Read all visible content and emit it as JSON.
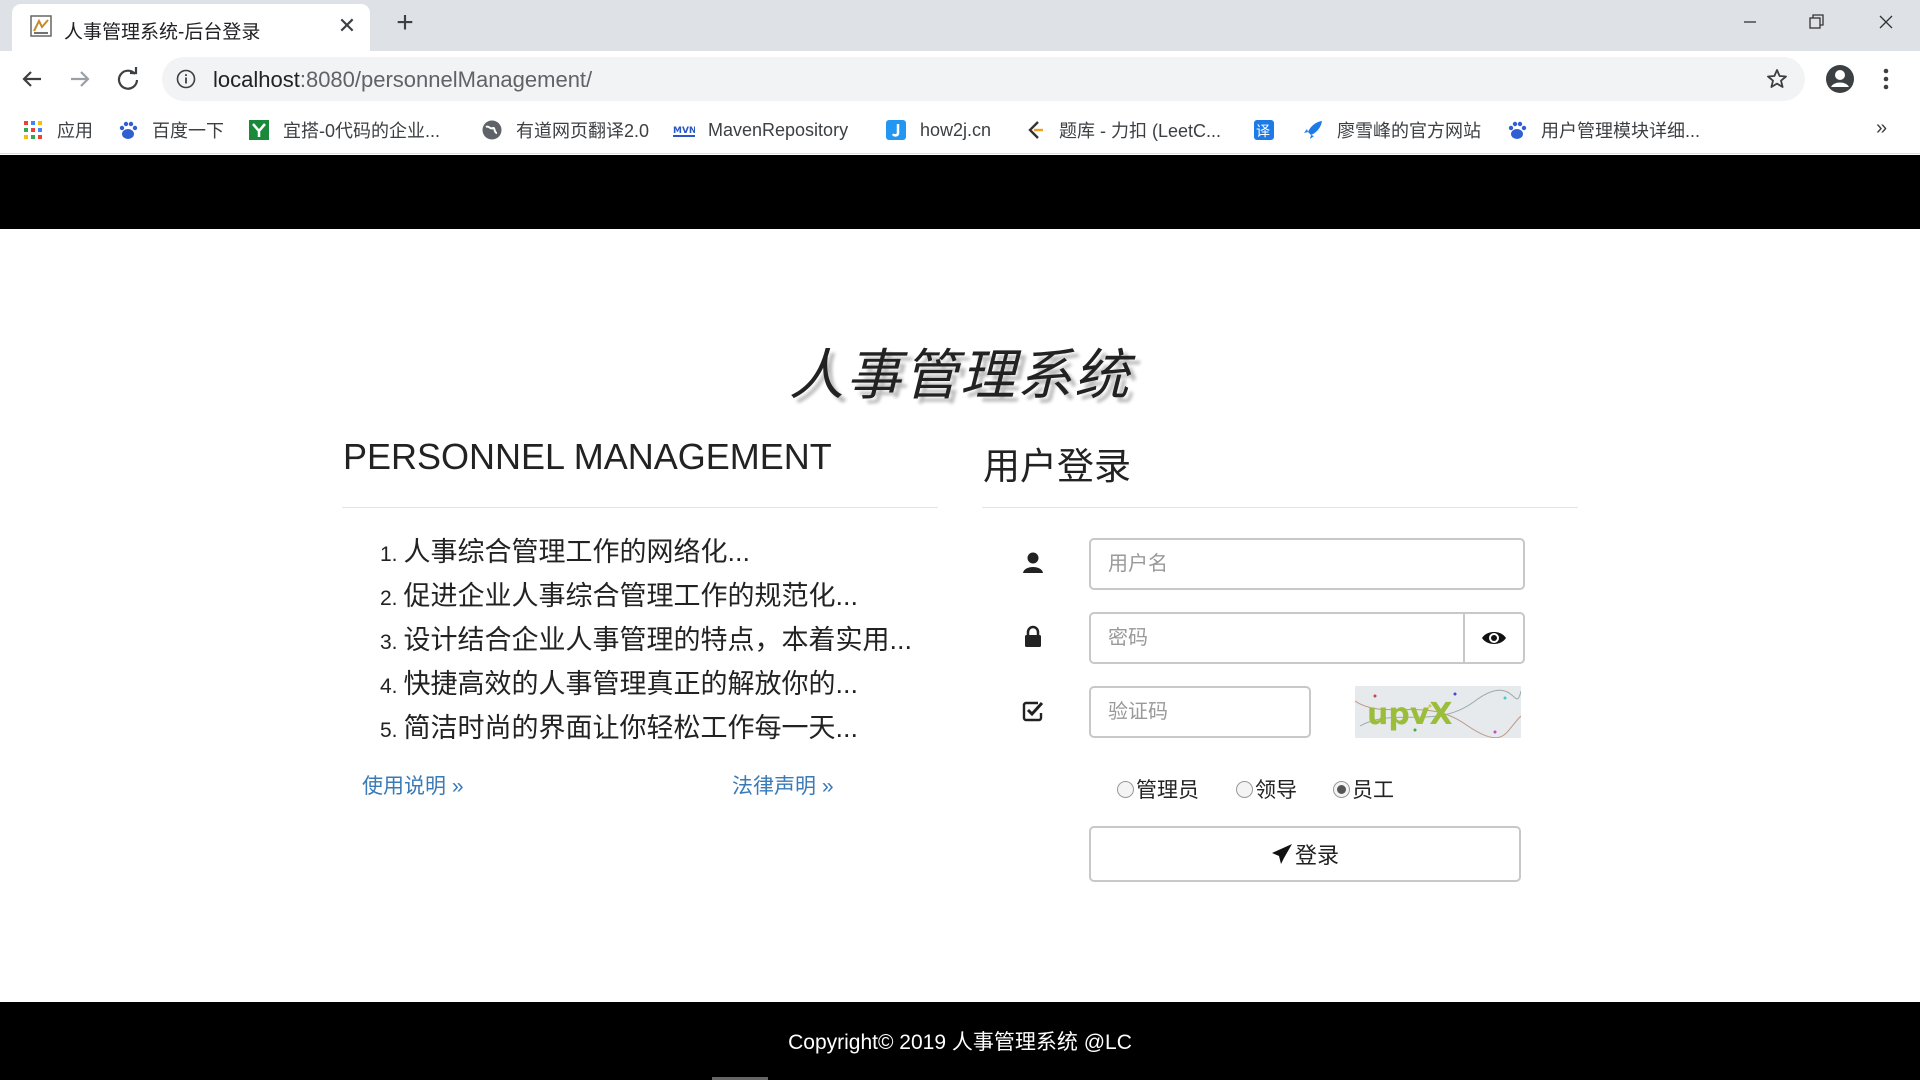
{
  "browser": {
    "tab_title": "人事管理系统-后台登录",
    "url_host": "localhost",
    "url_rest": ":8080/personnelManagement/",
    "bookmarks": [
      {
        "label": "应用",
        "icon": "apps-grid-icon"
      },
      {
        "label": "百度一下",
        "icon": "baidu-paw-icon"
      },
      {
        "label": "宜搭-0代码的企业...",
        "icon": "yida-icon"
      },
      {
        "label": "有道网页翻译2.0",
        "icon": "globe-icon"
      },
      {
        "label": "MavenRepository",
        "icon": "maven-icon"
      },
      {
        "label": "how2j.cn",
        "icon": "how2j-icon"
      },
      {
        "label": "题库 - 力扣 (LeetC...",
        "icon": "leetcode-icon"
      },
      {
        "label": "",
        "icon": "translate-icon"
      },
      {
        "label": "廖雪峰的官方网站",
        "icon": "rocket-icon"
      },
      {
        "label": "用户管理模块详细...",
        "icon": "baidu-paw-icon"
      }
    ],
    "more_bookmarks": "»"
  },
  "page": {
    "title": "人事管理系统",
    "left_heading": "PERSONNEL MANAGEMENT",
    "features": [
      {
        "num": "1.",
        "text": "人事综合管理工作的网络化..."
      },
      {
        "num": "2.",
        "text": "促进企业人事综合管理工作的规范化..."
      },
      {
        "num": "3.",
        "text": "设计结合企业人事管理的特点，本着实用..."
      },
      {
        "num": "4.",
        "text": "快捷高效的人事管理真正的解放你的..."
      },
      {
        "num": "5.",
        "text": "简洁时尚的界面让你轻松工作每一天..."
      }
    ],
    "help_link": "使用说明 »",
    "legal_link": "法律声明 »",
    "login": {
      "heading": "用户登录",
      "username_placeholder": "用户名",
      "password_placeholder": "密码",
      "captcha_placeholder": "验证码",
      "captcha_text": "upvX",
      "roles": [
        {
          "label": "管理员",
          "checked": false
        },
        {
          "label": "领导",
          "checked": false
        },
        {
          "label": "员工",
          "checked": true
        }
      ],
      "submit_label": "登录"
    },
    "footer": "Copyright© 2019 人事管理系统 @LC"
  },
  "colors": {
    "bar_black": "#000000",
    "link_blue": "#3a7ab6",
    "border_gray": "#c8c8c8"
  }
}
